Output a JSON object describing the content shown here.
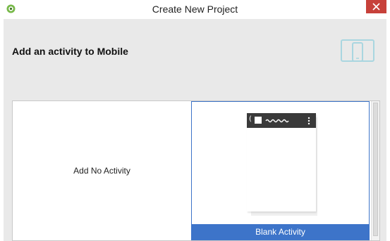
{
  "window": {
    "title": "Create New Project",
    "app_icon": "android-studio-icon",
    "close_icon": "close-icon"
  },
  "page": {
    "title": "Add an activity to Mobile",
    "device_icon": "devices-icon"
  },
  "gallery": {
    "tiles": [
      {
        "label": "Add No Activity",
        "selected": false
      },
      {
        "label": "Blank Activity",
        "selected": true
      }
    ],
    "preview": {
      "back_glyph": "(",
      "menu_icon": "overflow-menu-icon"
    }
  },
  "colors": {
    "accent": "#3d74c9",
    "close": "#c7413a",
    "dialog_bg": "#e9e9e9",
    "device_icon": "#a9d6e0"
  }
}
